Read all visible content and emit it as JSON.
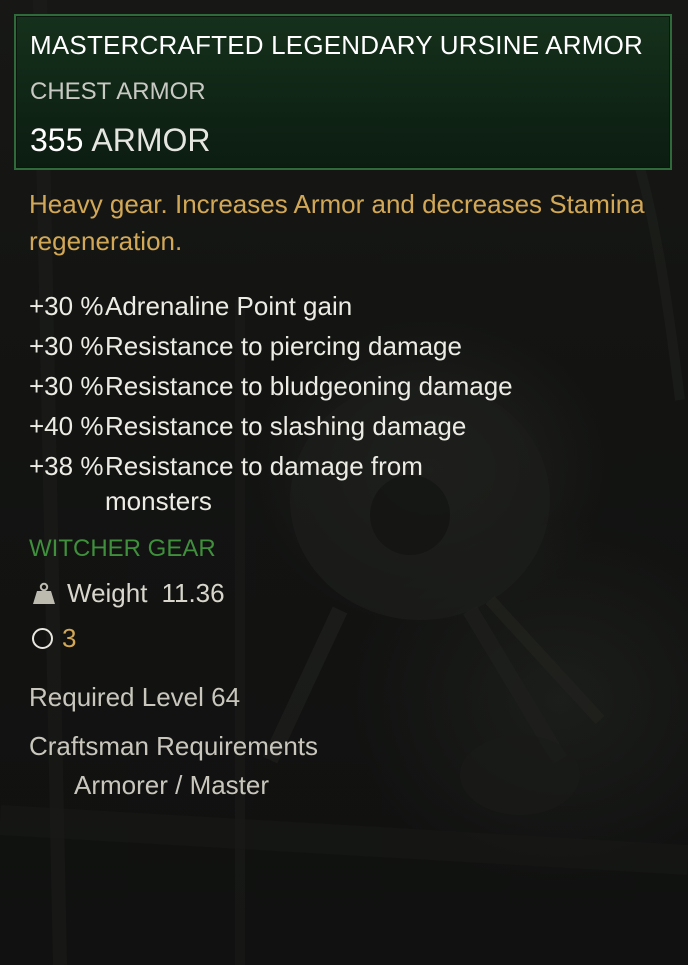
{
  "item": {
    "name": "MASTERCRAFTED LEGENDARY URSINE ARMOR",
    "type": "CHEST ARMOR",
    "stat_value": "355",
    "stat_unit": "ARMOR"
  },
  "description": "Heavy gear. Increases Armor and decreases Stamina regeneration.",
  "bonuses": [
    {
      "value": "+30 %",
      "text": "Adrenaline Point gain"
    },
    {
      "value": "+30 %",
      "text": "Resistance to piercing damage"
    },
    {
      "value": "+30 %",
      "text": "Resistance to bludgeoning damage"
    },
    {
      "value": "+40 %",
      "text": "Resistance to slashing damage"
    },
    {
      "value": "+38 %",
      "text": "Resistance to damage from monsters"
    }
  ],
  "set_label": "WITCHER GEAR",
  "weight": {
    "icon": "weight-icon",
    "label": "Weight",
    "value": "11.36"
  },
  "sockets": {
    "icon": "socket-icon",
    "count": "3"
  },
  "required_level": "Required Level 64",
  "crafting": {
    "label": "Craftsman Requirements",
    "value": "Armorer / Master"
  },
  "colors": {
    "header_border": "#2f6a3a",
    "header_bg": "#15311c",
    "description": "#d2a857",
    "set_label": "#3f8f3c",
    "socket_count": "#d2a857"
  }
}
